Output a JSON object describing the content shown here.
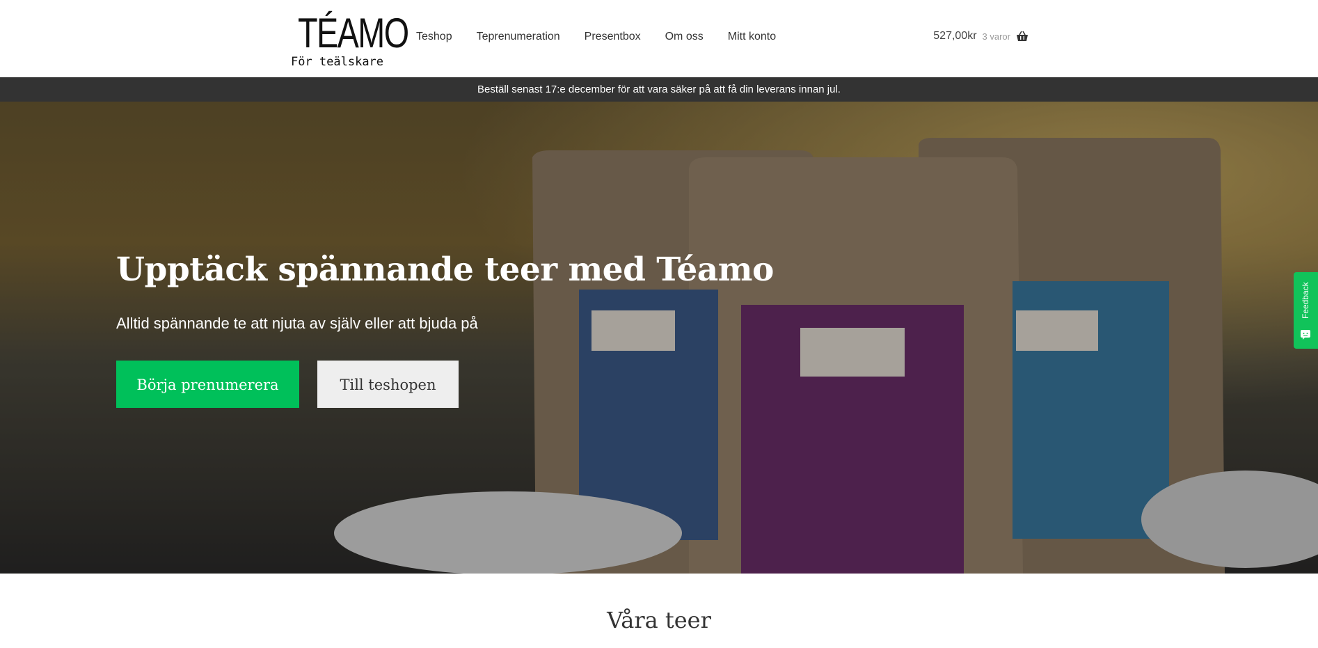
{
  "logo": {
    "main": "TÉAMO",
    "sub": "För teälskare"
  },
  "nav": {
    "items": [
      "Teshop",
      "Teprenumeration",
      "Presentbox",
      "Om oss",
      "Mitt konto"
    ]
  },
  "cart": {
    "amount": "527,00kr",
    "count": "3 varor",
    "icon": "basket-icon"
  },
  "notice": {
    "text": "Beställ senast 17:e december för att vara säker på att få din leverans innan jul."
  },
  "hero": {
    "title": "Upptäck spännande teer med Téamo",
    "subtitle": "Alltid spännande te att njuta av själv eller att bjuda på",
    "primary_button": "Börja prenumerera",
    "secondary_button": "Till teshopen"
  },
  "feedback": {
    "label": "Feedback",
    "icon": "chat-icon"
  },
  "section": {
    "title": "Våra teer"
  },
  "colors": {
    "accent_green": "#00c05a",
    "notice_bar": "#333333",
    "secondary_button": "#eeeeee"
  }
}
